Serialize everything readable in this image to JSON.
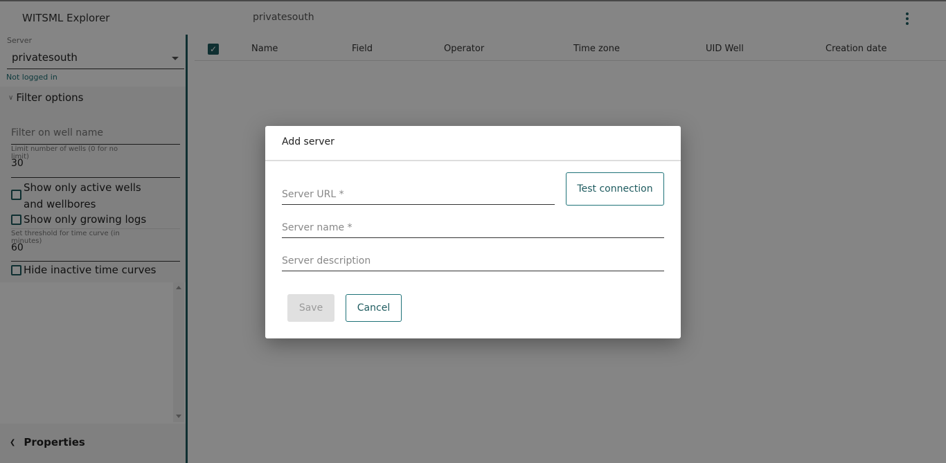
{
  "app": {
    "title": "WITSML Explorer",
    "current_server": "privatesouth",
    "menu_icon": "more-vert-icon"
  },
  "sidebar": {
    "server_label": "Server",
    "server_value": "privatesouth",
    "login_status": "Not logged in",
    "filter_options_label": "Filter options",
    "filter_well_name_placeholder": "Filter on well name",
    "limit_wells_label": "Limit number of wells (0 for no limit)",
    "limit_wells_value": "30",
    "show_active_label": "Show only active wells and wellbores",
    "show_growing_label": "Show only growing logs",
    "threshold_label": "Set threshold for time curve (in minutes)",
    "threshold_value": "60",
    "hide_inactive_label": "Hide inactive time curves",
    "properties_label": "Properties"
  },
  "table": {
    "columns": [
      "Name",
      "Field",
      "Operator",
      "Time zone",
      "UID Well",
      "Creation date"
    ]
  },
  "dialog": {
    "title": "Add server",
    "server_url_placeholder": "Server URL *",
    "server_name_placeholder": "Server name *",
    "server_description_placeholder": "Server description",
    "test_connection_label": "Test connection",
    "save_label": "Save",
    "cancel_label": "Cancel"
  },
  "colors": {
    "accent": "#1e5b5f",
    "link": "#1e7278"
  }
}
